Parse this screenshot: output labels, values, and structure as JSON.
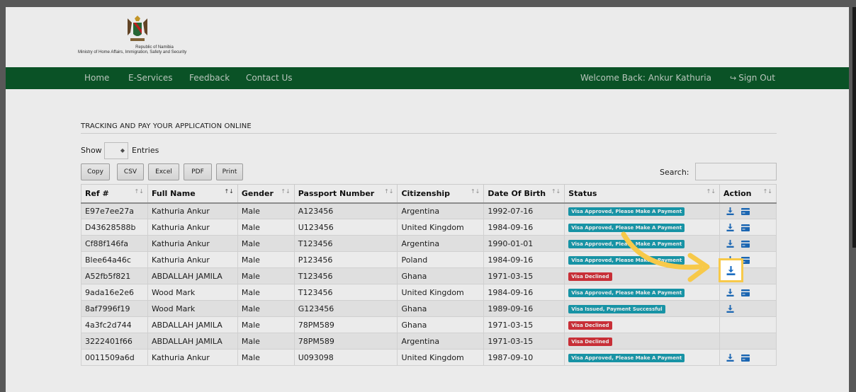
{
  "header": {
    "logo_line1": "Republic of Namibia",
    "logo_line2": "Ministry of Home Affairs, Immigration, Safety and Security"
  },
  "nav": {
    "items": [
      "Home",
      "E-Services",
      "Feedback",
      "Contact Us"
    ],
    "welcome": "Welcome Back: Ankur Kathuria",
    "signout": "Sign Out"
  },
  "content": {
    "title": "TRACKING AND PAY YOUR APPLICATION ONLINE",
    "show_label": "Show",
    "entries_label": "Entries",
    "buttons": [
      "Copy",
      "CSV",
      "Excel",
      "PDF",
      "Print"
    ],
    "search_label": "Search:",
    "search_value": ""
  },
  "table": {
    "headers": [
      "Ref #",
      "Full Name",
      "Gender",
      "Passport Number",
      "Citizenship",
      "Date Of Birth",
      "Status",
      "Action"
    ],
    "rows": [
      {
        "ref": "E97e7ee27a",
        "name": "Kathuria Ankur",
        "gender": "Male",
        "passport": "A123456",
        "citizenship": "Argentina",
        "dob": "1992-07-16",
        "status": "Visa Approved, Please Make A Payment",
        "status_type": "approved",
        "download": true,
        "pay": true
      },
      {
        "ref": "D43628588b",
        "name": "Kathuria Ankur",
        "gender": "Male",
        "passport": "U123456",
        "citizenship": "United Kingdom",
        "dob": "1984-09-16",
        "status": "Visa Approved, Please Make A Payment",
        "status_type": "approved",
        "download": true,
        "pay": true
      },
      {
        "ref": "Cf88f146fa",
        "name": "Kathuria Ankur",
        "gender": "Male",
        "passport": "T123456",
        "citizenship": "Argentina",
        "dob": "1990-01-01",
        "status": "Visa Approved, Please Make A Payment",
        "status_type": "approved",
        "download": true,
        "pay": true
      },
      {
        "ref": "Blee64a46c",
        "name": "Kathuria Ankur",
        "gender": "Male",
        "passport": "P123456",
        "citizenship": "Poland",
        "dob": "1984-09-16",
        "status": "Visa Approved, Please Make A Payment",
        "status_type": "approved",
        "download": true,
        "pay": true
      },
      {
        "ref": "A52fb5f821",
        "name": "ABDALLAH JAMILA",
        "gender": "Male",
        "passport": "T123456",
        "citizenship": "Ghana",
        "dob": "1971-03-15",
        "status": "Visa Declined",
        "status_type": "declined",
        "download": false,
        "pay": false
      },
      {
        "ref": "9ada16e2e6",
        "name": "Wood Mark",
        "gender": "Male",
        "passport": "T123456",
        "citizenship": "United Kingdom",
        "dob": "1984-09-16",
        "status": "Visa Approved, Please Make A Payment",
        "status_type": "approved",
        "download": true,
        "pay": true
      },
      {
        "ref": "8af7996f19",
        "name": "Wood Mark",
        "gender": "Male",
        "passport": "G123456",
        "citizenship": "Ghana",
        "dob": "1989-09-16",
        "status": "Visa Issued, Payment Successful",
        "status_type": "issued",
        "download": true,
        "pay": false
      },
      {
        "ref": "4a3fc2d744",
        "name": "ABDALLAH JAMILA",
        "gender": "Male",
        "passport": "78PM589",
        "citizenship": "Ghana",
        "dob": "1971-03-15",
        "status": "Visa Declined",
        "status_type": "declined",
        "download": false,
        "pay": false
      },
      {
        "ref": "3222401f66",
        "name": "ABDALLAH JAMILA",
        "gender": "Male",
        "passport": "78PM589",
        "citizenship": "Argentina",
        "dob": "1971-03-15",
        "status": "Visa Declined",
        "status_type": "declined",
        "download": false,
        "pay": false
      },
      {
        "ref": "0011509a6d",
        "name": "Kathuria Ankur",
        "gender": "Male",
        "passport": "U093098",
        "citizenship": "United Kingdom",
        "dob": "1987-09-10",
        "status": "Visa Approved, Please Make A Payment",
        "status_type": "approved",
        "download": true,
        "pay": true
      }
    ]
  },
  "colors": {
    "nav_bg": "#0b5a2a",
    "approved": "#1aa0b3",
    "declined": "#d9343c",
    "action_icon": "#1e6fc2",
    "highlight": "#f7c94a"
  },
  "icons": {
    "download": "download-icon",
    "pay": "credit-card-icon",
    "signout": "sign-out-icon",
    "sort": "sort-arrows-icon"
  }
}
